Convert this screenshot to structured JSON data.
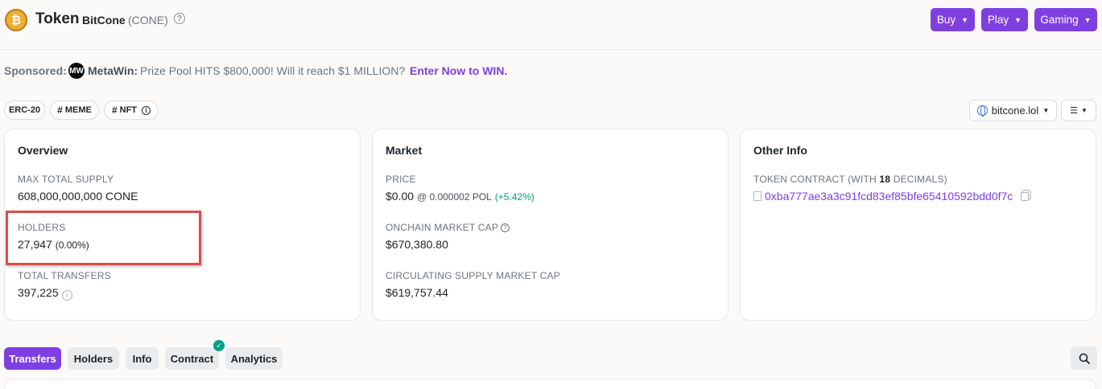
{
  "header": {
    "logo_glyph": "₿",
    "title": "Token",
    "token_name": "BitCone",
    "token_symbol": "(CONE)",
    "buttons": [
      {
        "label": "Buy"
      },
      {
        "label": "Play"
      },
      {
        "label": "Gaming"
      }
    ]
  },
  "sponsored": {
    "label": "Sponsored:",
    "brand_icon": "MW",
    "brand": "MetaWin:",
    "text": "Prize Pool HITS $800,000! Will it reach $1 MILLION?",
    "link": "Enter Now to WIN."
  },
  "tags": [
    {
      "label": "ERC-20"
    },
    {
      "label": "MEME"
    },
    {
      "label": "NFT"
    }
  ],
  "site": {
    "label": "bitcone.lol"
  },
  "overview": {
    "title": "Overview",
    "max_supply_label": "MAX TOTAL SUPPLY",
    "max_supply_value": "608,000,000,000 CONE",
    "holders_label": "HOLDERS",
    "holders_value": "27,947",
    "holders_change": "(0.00%)",
    "transfers_label": "TOTAL TRANSFERS",
    "transfers_value": "397,225"
  },
  "market": {
    "title": "Market",
    "price_label": "PRICE",
    "price_value": "$0.00",
    "price_native": "@ 0.000002 POL",
    "price_change": "(+5.42%)",
    "mcap_label": "ONCHAIN MARKET CAP",
    "mcap_value": "$670,380.80",
    "circ_label": "CIRCULATING SUPPLY MARKET CAP",
    "circ_value": "$619,757.44"
  },
  "other_info": {
    "title": "Other Info",
    "contract_label_prefix": "TOKEN CONTRACT (WITH ",
    "decimals": "18",
    "contract_label_suffix": " DECIMALS)",
    "contract_address": "0xba777ae3a3c91fcd83ef85bfe65410592bdd0f7c"
  },
  "tabs": [
    {
      "label": "Transfers",
      "active": true
    },
    {
      "label": "Holders"
    },
    {
      "label": "Info"
    },
    {
      "label": "Contract"
    },
    {
      "label": "Analytics"
    }
  ],
  "colors": {
    "accent": "#7f3fe0",
    "positive": "#00a186",
    "highlight": "#e04a4a"
  }
}
